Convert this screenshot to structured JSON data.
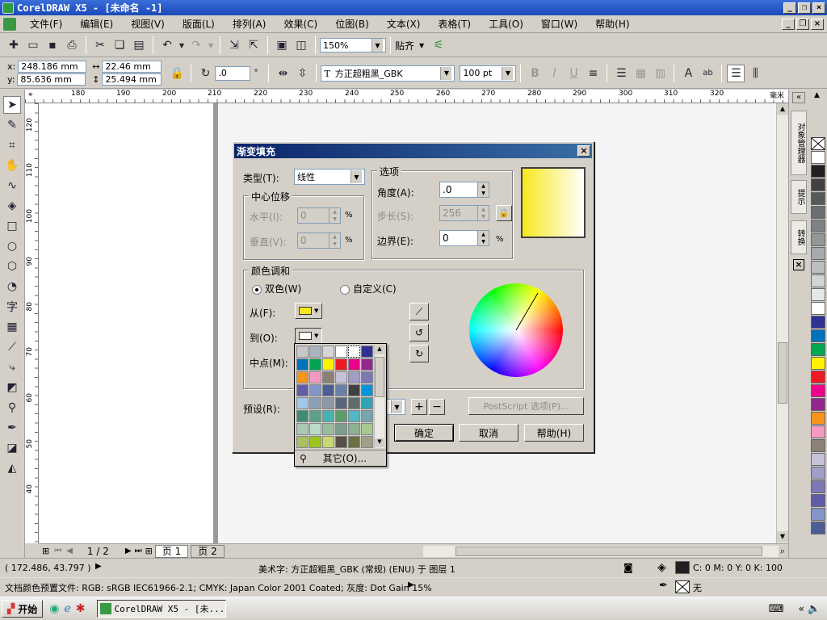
{
  "window": {
    "title": "CorelDRAW X5 - [未命名 -1]"
  },
  "menu": [
    "文件(F)",
    "编辑(E)",
    "视图(V)",
    "版面(L)",
    "排列(A)",
    "效果(C)",
    "位图(B)",
    "文本(X)",
    "表格(T)",
    "工具(O)",
    "窗口(W)",
    "帮助(H)"
  ],
  "standard_toolbar": {
    "zoom": "150%",
    "snap_label": "贴齐"
  },
  "property_bar": {
    "x": "248.186 mm",
    "y": "85.636 mm",
    "width": "22.46 mm",
    "height": "25.494 mm",
    "angle": ".0",
    "font": "方正超粗黑_GBK",
    "font_size": "100 pt"
  },
  "ruler": {
    "unit": "毫米",
    "h_ticks": [
      "180",
      "190",
      "200",
      "210",
      "220",
      "230",
      "240",
      "250",
      "260",
      "270",
      "280",
      "290",
      "300",
      "310",
      "320"
    ],
    "v_ticks": [
      "120",
      "110",
      "100",
      "90",
      "80",
      "70",
      "60",
      "50",
      "40"
    ]
  },
  "docker_tabs": [
    "对象管理器",
    "提示",
    "转换"
  ],
  "palette_colors": [
    "#ffffff",
    "#231f20",
    "#414042",
    "#58595b",
    "#6d6e71",
    "#808285",
    "#939598",
    "#a7a9ac",
    "#bcbec0",
    "#d1d3d4",
    "#e6e7e8",
    "#ffffff",
    "#2e3192",
    "#0072bc",
    "#00a651",
    "#fff200",
    "#ed1c24",
    "#ec008c",
    "#92278f",
    "#f7941d",
    "#f49ac1",
    "#8b8178",
    "#c5c1d9",
    "#a19dc8",
    "#7d78b3",
    "#605ca8",
    "#8394c6",
    "#4d5e96"
  ],
  "pages": {
    "counter": "1 / 2",
    "tabs": [
      "页 1",
      "页 2"
    ]
  },
  "status": {
    "coords": "( 172.486, 43.797 )",
    "object_info": "美术字: 方正超粗黑_GBK (常规) (ENU) 于 图层 1",
    "fill_info": "C: 0 M: 0 Y: 0 K: 100",
    "outline_info": "无",
    "color_profile": "文档颜色预置文件: RGB: sRGB IEC61966-2.1; CMYK: Japan Color 2001 Coated; 灰度: Dot Gain 15%"
  },
  "dialog": {
    "title": "渐变填充",
    "type_label": "类型(T):",
    "type_value": "线性",
    "center_group": "中心位移",
    "horiz_label": "水平(I):",
    "horiz_value": "0",
    "vert_label": "垂直(V):",
    "vert_value": "0",
    "percent": "%",
    "options_group": "选项",
    "angle_label": "角度(A):",
    "angle_value": ".0",
    "steps_label": "步长(S):",
    "steps_value": "256",
    "edge_label": "边界(E):",
    "edge_value": "0",
    "blend_group": "颜色调和",
    "two_color": "双色(W)",
    "custom": "自定义(C)",
    "from_label": "从(F):",
    "to_label": "到(O):",
    "mid_label": "中点(M):",
    "from_color": "#f7e81f",
    "to_color": "#ffffff",
    "presets_label": "预设(R):",
    "postscript_btn": "PostScript 选项(P)...",
    "ok_btn": "确定",
    "cancel_btn": "取消",
    "help_btn": "帮助(H)",
    "preview_gradient": [
      "#f7e81f",
      "#ffffff"
    ]
  },
  "color_popup": {
    "others": "其它(O)...",
    "colors": [
      "#c8c8c8",
      "#a9b4bf",
      "#d7d7d7",
      "#ffffff",
      "#ffffff",
      "#2e3192",
      "#0072bc",
      "#00a651",
      "#fff200",
      "#ed1c24",
      "#ec008c",
      "#92278f",
      "#f7941d",
      "#f49ac1",
      "#8b8178",
      "#c5c1d9",
      "#a19dc8",
      "#7d78b3",
      "#605ca8",
      "#8394c6",
      "#4d5e96",
      "#6c7fa8",
      "#414042",
      "#0095da",
      "#a0c8e8",
      "#8aa0b4",
      "#8c98a4",
      "#586878",
      "#606c6c",
      "#30a4b4",
      "#3c8c78",
      "#5ca08c",
      "#44b4b4",
      "#5c9c6c",
      "#50b8c8",
      "#78a4b0",
      "#a8c8b0",
      "#b8dcc8",
      "#98bca0",
      "#7c9c8c",
      "#8cb090",
      "#a8c890",
      "#a8c060",
      "#9cc41c",
      "#c8d870",
      "#585048",
      "#6c7040",
      "#a0a088"
    ]
  }
}
